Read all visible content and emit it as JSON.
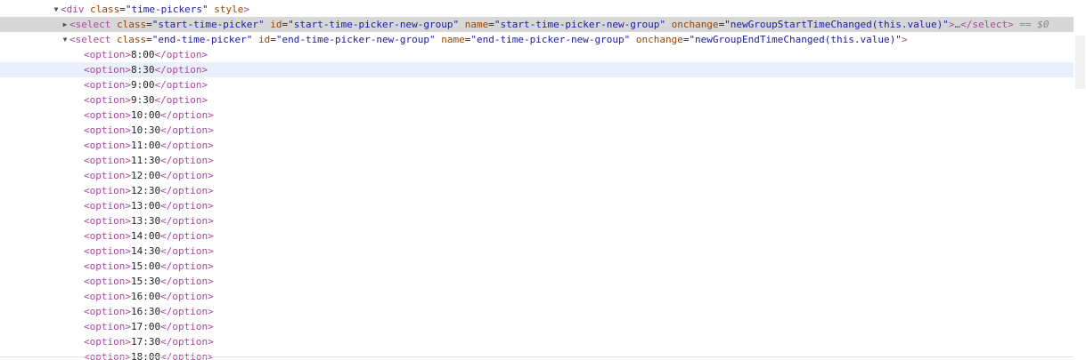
{
  "elements_panel": {
    "div_node": {
      "arrow": "▼",
      "open": "<div",
      "attr_class": " class",
      "eq": "=",
      "class_value": "\"time-pickers\"",
      "attr_style": " style",
      "close": ">"
    },
    "start_select_node": {
      "arrow": "▶",
      "open": "<select",
      "attr_class": " class",
      "class_value": "\"start-time-picker\"",
      "attr_id": " id",
      "id_value": "\"start-time-picker-new-group\"",
      "attr_name": " name",
      "name_value": "\"start-time-picker-new-group\"",
      "attr_onchange": " onchange",
      "onchange_value": "\"newGroupStartTimeChanged(this.value)\"",
      "gt": ">",
      "ellipsis": "…",
      "close": "</select>",
      "console_ref": " == $0"
    },
    "end_select_node": {
      "arrow": "▼",
      "open": "<select",
      "attr_class": " class",
      "class_value": "\"end-time-picker\"",
      "attr_id": " id",
      "id_value": "\"end-time-picker-new-group\"",
      "attr_name": " name",
      "name_value": "\"end-time-picker-new-group\"",
      "attr_onchange": " onchange",
      "onchange_value": "\"newGroupEndTimeChanged(this.value)\"",
      "gt": ">"
    },
    "option_open": "<option>",
    "option_close": "</option>",
    "options": [
      "8:00",
      "8:30",
      "9:00",
      "9:30",
      "10:00",
      "10:30",
      "11:00",
      "11:30",
      "12:00",
      "12:30",
      "13:00",
      "13:30",
      "14:00",
      "14:30",
      "15:00",
      "15:30",
      "16:00",
      "16:30",
      "17:00",
      "17:30",
      "18:00"
    ]
  }
}
